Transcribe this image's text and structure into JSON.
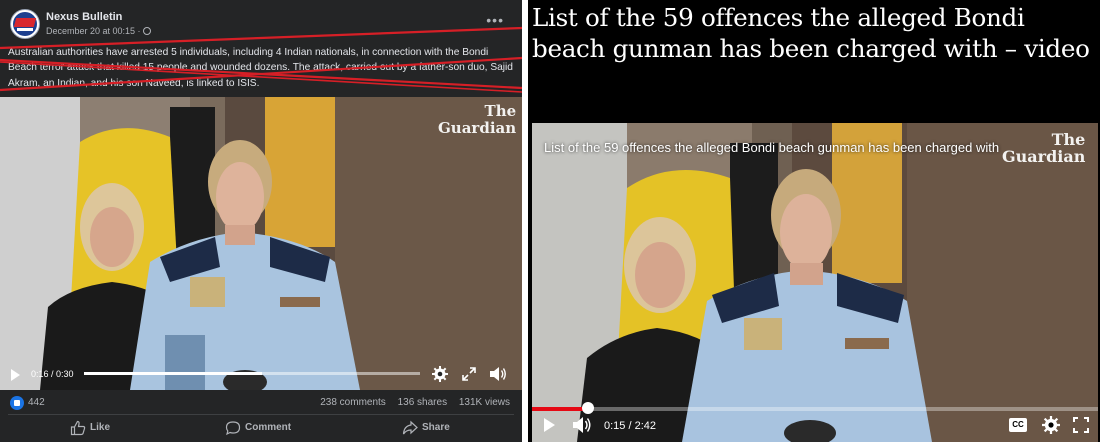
{
  "facebook_post": {
    "page_name": "Nexus Bulletin",
    "timestamp": "December 20 at 00:15 ·",
    "body_text": "Australian authorities have arrested 5 individuals, including 4 Indian nationals, in connection with the Bondi Beach terror attack that killed 15 people and wounded dozens. The attack, carried out by a father-son duo, Sajid Akram, an Indian, and his son Naveed, is linked to ISIS.",
    "more_icon": "more-options-icon",
    "video": {
      "watermark_line1": "The",
      "watermark_line2": "Guardian",
      "time": "0:16 / 0:30",
      "progress": 0.53
    },
    "reaction_count": "442",
    "comments": "238 comments",
    "shares": "136 shares",
    "views": "131K views",
    "actions": {
      "like": "Like",
      "comment": "Comment",
      "share": "Share"
    }
  },
  "guardian": {
    "headline": "List of the 59 offences the alleged Bondi beach gunman has been charged with – video",
    "video_caption": "List of the 59 offences the alleged Bondi beach gunman has been charged with",
    "watermark_line1": "The",
    "watermark_line2": "Guardian",
    "time": "0:15 / 2:42",
    "progress": 0.1,
    "cc_label": "CC",
    "accent_color": "#e50914"
  }
}
